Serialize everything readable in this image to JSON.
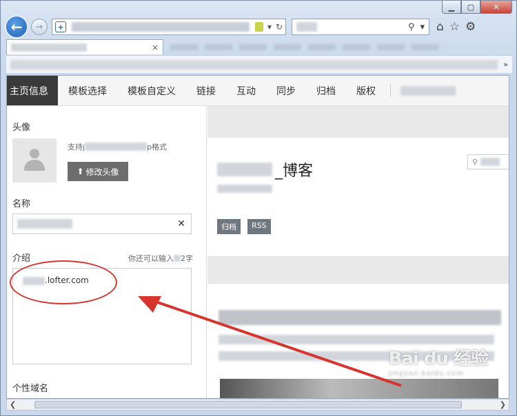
{
  "browser": {
    "caption_buttons": [
      "min",
      "max",
      "close"
    ],
    "url_placeholder_icon": "shield-plus-icon",
    "tab_close": "×",
    "favorites_more": "»"
  },
  "nav": {
    "items": [
      "主页信息",
      "模板选择",
      "模板自定义",
      "链接",
      "互动",
      "同步",
      "归档",
      "版权"
    ],
    "active": "主页信息"
  },
  "left": {
    "avatar_label": "头像",
    "avatar_hint": "支持j",
    "avatar_hint_tail": "p格式",
    "change_avatar": "修改头像",
    "name_label": "名称",
    "intro_label": "介绍",
    "intro_counter": "你还可以输入",
    "intro_counter_tail": "2字",
    "intro_value": ".lofter.com",
    "domain_label": "个性域名"
  },
  "right": {
    "blog_title_suffix": "_博客",
    "tags": [
      "归档",
      "RSS"
    ],
    "search_hint": "Q"
  },
  "watermark": {
    "logo": "Bai du 经验",
    "url": "jingyan.baidu.com"
  },
  "colors": {
    "nav_active_bg": "#3a3a3a",
    "annotation_red": "#d6352e",
    "browser_back_blue": "#1f5fb5"
  }
}
